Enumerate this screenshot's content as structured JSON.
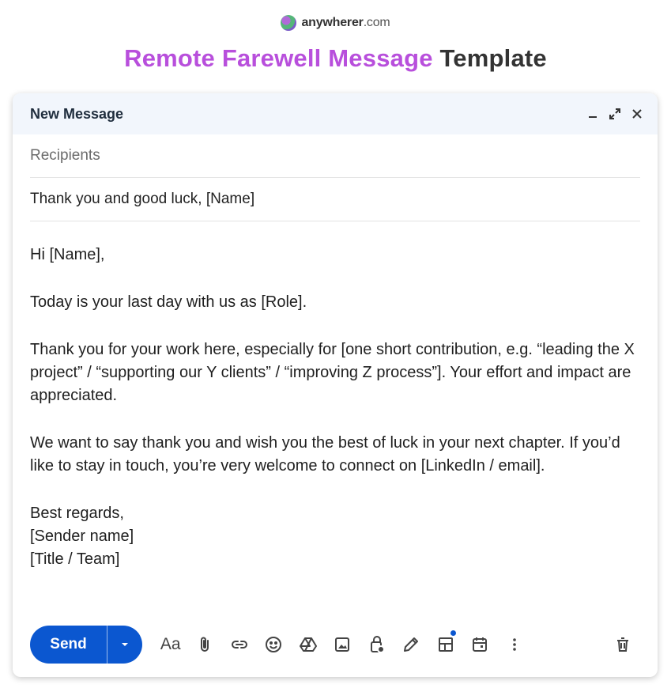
{
  "brand": {
    "name": "anywherer",
    "suffix": ".com"
  },
  "page_title": {
    "accent": "Remote Farewell Message",
    "rest": " Template"
  },
  "compose": {
    "title": "New Message",
    "recipients_placeholder": "Recipients",
    "subject": "Thank you and good luck, [Name]",
    "body": {
      "greeting": "Hi [Name],",
      "p1": "Today is your last day with us as [Role].",
      "p2": "Thank you for your work here, especially for [one short contribution, e.g. “leading the X project” / “supporting our Y clients” / “improving Z process”]. Your effort and impact are appreciated.",
      "p3": "We want to say thank you and wish you the best of luck in your next chapter. If you’d like to stay in touch, you’re very welcome to connect on [LinkedIn / email].",
      "closing": "Best regards,",
      "sender_name": "[Sender name]",
      "sender_title": "[Title / Team]"
    },
    "send_label": "Send",
    "format_label": "Aa"
  },
  "icons": [
    "minimize-icon",
    "expand-icon",
    "close-icon",
    "chevron-down-icon",
    "attach-icon",
    "link-icon",
    "emoji-icon",
    "drive-icon",
    "photo-icon",
    "lock-clock-icon",
    "pen-icon",
    "layout-icon",
    "calendar-icon",
    "more-vert-icon",
    "trash-icon"
  ],
  "colors": {
    "accent": "#b84fdc",
    "send": "#0b57d0",
    "header_bg": "#f2f6fc"
  }
}
